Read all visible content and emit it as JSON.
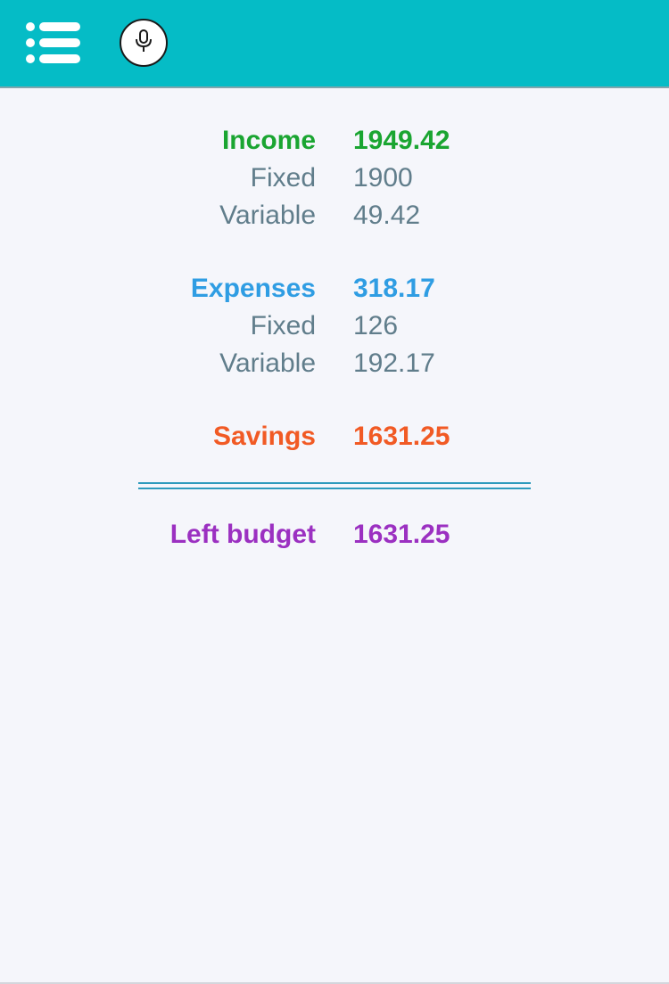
{
  "header": {
    "menu_icon": "hamburger-list-icon",
    "mic_icon": "microphone-icon",
    "background_color": "#05bcc6"
  },
  "summary": {
    "income": {
      "label": "Income",
      "value": "1949.42",
      "color": "#1aa531"
    },
    "income_fixed": {
      "label": "Fixed",
      "value": "1900"
    },
    "income_variable": {
      "label": "Variable",
      "value": "49.42"
    },
    "expenses": {
      "label": "Expenses",
      "value": "318.17",
      "color": "#2f9de3"
    },
    "expenses_fixed": {
      "label": "Fixed",
      "value": "126"
    },
    "expenses_variable": {
      "label": "Variable",
      "value": "192.17"
    },
    "savings": {
      "label": "Savings",
      "value": "1631.25",
      "color": "#f15a24"
    },
    "left_budget": {
      "label": "Left budget",
      "value": "1631.25",
      "color": "#9b30c1"
    }
  },
  "colors": {
    "sub_text": "#607d8b",
    "divider": "#2e9bbd",
    "page_background": "#f5f6fb"
  }
}
